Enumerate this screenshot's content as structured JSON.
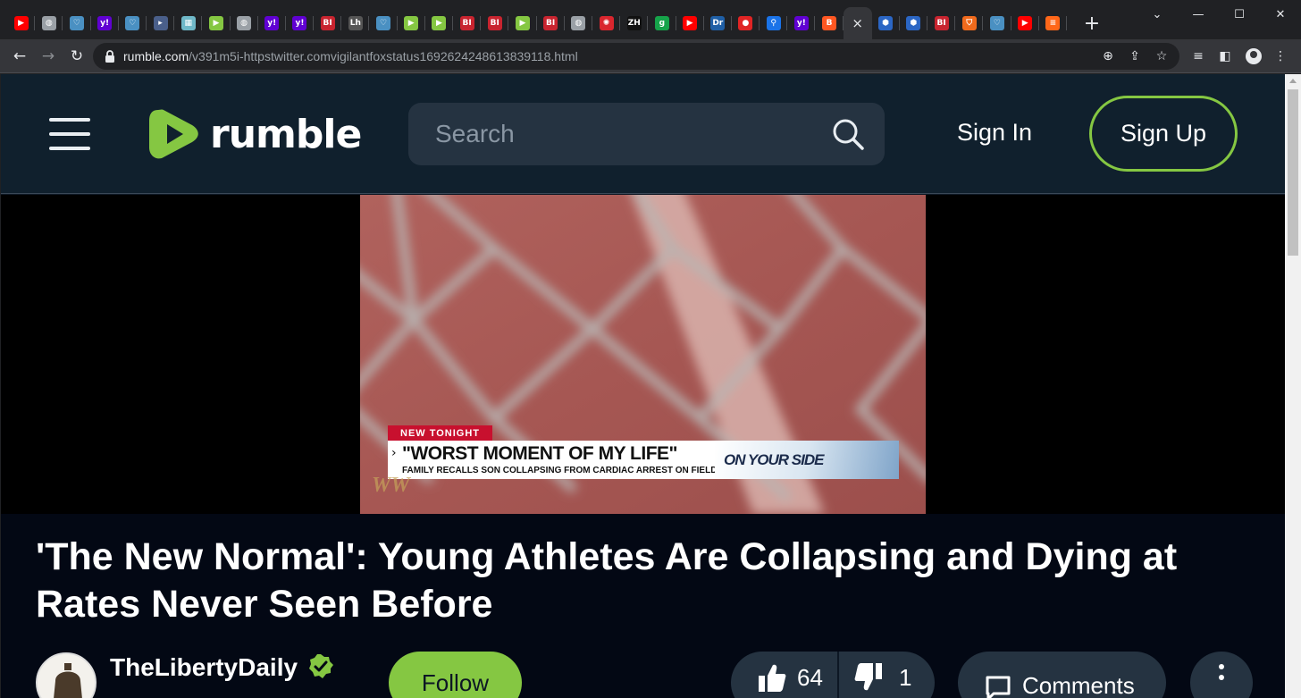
{
  "browser": {
    "tabs": [
      {
        "icon": "youtube-icon",
        "color": "#ff0000",
        "glyph": "▶"
      },
      {
        "icon": "globe-icon",
        "color": "#9aa0a6",
        "glyph": "◍"
      },
      {
        "icon": "heart-shield-icon",
        "color": "#4a90c2",
        "glyph": "♡"
      },
      {
        "icon": "yahoo-icon",
        "color": "#6001d2",
        "glyph": "y!"
      },
      {
        "icon": "heart-shield-icon",
        "color": "#4a90c2",
        "glyph": "♡"
      },
      {
        "icon": "arrow-tag-icon",
        "color": "#4a5f8a",
        "glyph": "▸"
      },
      {
        "icon": "pattern-icon",
        "color": "#6fb8c8",
        "glyph": "▦"
      },
      {
        "icon": "rumble-icon",
        "color": "#85c742",
        "glyph": "▶"
      },
      {
        "icon": "globe-icon",
        "color": "#9aa0a6",
        "glyph": "◍"
      },
      {
        "icon": "yahoo-icon",
        "color": "#6001d2",
        "glyph": "y!"
      },
      {
        "icon": "yahoo-icon",
        "color": "#6001d2",
        "glyph": "y!"
      },
      {
        "icon": "business-insider-icon",
        "color": "#c8242f",
        "glyph": "BI"
      },
      {
        "icon": "lh-icon",
        "color": "#555555",
        "glyph": "Lh"
      },
      {
        "icon": "heart-shield-icon",
        "color": "#4a90c2",
        "glyph": "♡"
      },
      {
        "icon": "rumble-icon",
        "color": "#85c742",
        "glyph": "▶"
      },
      {
        "icon": "rumble-icon",
        "color": "#85c742",
        "glyph": "▶"
      },
      {
        "icon": "business-insider-icon",
        "color": "#c8242f",
        "glyph": "BI"
      },
      {
        "icon": "business-insider-icon",
        "color": "#c8242f",
        "glyph": "BI"
      },
      {
        "icon": "rumble-icon",
        "color": "#85c742",
        "glyph": "▶"
      },
      {
        "icon": "business-insider-icon",
        "color": "#c8242f",
        "glyph": "BI"
      },
      {
        "icon": "globe-icon",
        "color": "#9aa0a6",
        "glyph": "◍"
      },
      {
        "icon": "starburst-icon",
        "color": "#d9262e",
        "glyph": "✺"
      },
      {
        "icon": "zh-icon",
        "color": "#111111",
        "glyph": "ZH"
      },
      {
        "icon": "g-icon",
        "color": "#16a34a",
        "glyph": "g"
      },
      {
        "icon": "youtube-icon",
        "color": "#ff0000",
        "glyph": "▶"
      },
      {
        "icon": "dr-icon",
        "color": "#1f5fa6",
        "glyph": "Dr"
      },
      {
        "icon": "microphone-icon",
        "color": "#e02424",
        "glyph": "●"
      },
      {
        "icon": "search-small-icon",
        "color": "#1a73e8",
        "glyph": "⚲"
      },
      {
        "icon": "yahoo-icon",
        "color": "#6001d2",
        "glyph": "y!"
      },
      {
        "icon": "blogger-icon",
        "color": "#ff5722",
        "glyph": "B"
      }
    ],
    "tabs_after_active": [
      {
        "icon": "cube-icon",
        "color": "#2b66c4",
        "glyph": "⬢"
      },
      {
        "icon": "cube-icon",
        "color": "#2b66c4",
        "glyph": "⬢"
      },
      {
        "icon": "business-insider-icon",
        "color": "#c8242f",
        "glyph": "BI"
      },
      {
        "icon": "shield-icon",
        "color": "#f06a1c",
        "glyph": "⛉"
      },
      {
        "icon": "heart-shield-icon",
        "color": "#4a90c2",
        "glyph": "♡"
      },
      {
        "icon": "youtube-icon",
        "color": "#ff0000",
        "glyph": "▶"
      },
      {
        "icon": "substack-icon",
        "color": "#ff6719",
        "glyph": "≡"
      }
    ],
    "active_tab_close": "×",
    "new_tab": "+",
    "url_host": "rumble.com",
    "url_path": "/v391m5i-httpstwitter.comvigilantfoxstatus1692624248613839118.html"
  },
  "header": {
    "logo_text": "rumble",
    "search_placeholder": "Search",
    "sign_in": "Sign In",
    "sign_up": "Sign Up"
  },
  "video": {
    "tag": "NEW TONIGHT",
    "headline": "\"WORST MOMENT OF MY LIFE\"",
    "subheadline": "FAMILY RECALLS SON COLLAPSING FROM CARDIAC ARREST ON FIELD",
    "segment_brand": "ON YOUR SIDE",
    "station_bug": "WW"
  },
  "main": {
    "title": "'The New Normal': Young Athletes Are Collapsing and Dying at Rates Never Seen Before",
    "channel_name": "TheLibertyDaily",
    "follow_label": "Follow",
    "likes": "64",
    "dislikes": "1",
    "comments_label": "Comments"
  },
  "colors": {
    "rumble_green": "#85c742",
    "header_bg": "#10202d",
    "content_bg": "#030814",
    "pill_bg": "#253341"
  }
}
